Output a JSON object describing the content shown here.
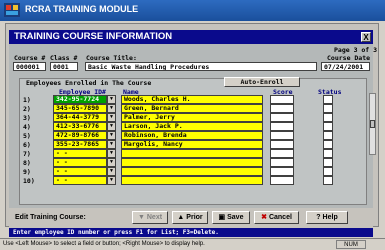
{
  "window": {
    "title": "RCRA TRAINING MODULE",
    "logo_icon": "rcra-logo-icon"
  },
  "form": {
    "title": "TRAINING COURSE INFORMATION",
    "close_label": "X",
    "page_info": "Page 3 of 3",
    "headers": {
      "course_num": "Course #",
      "class_num": "Class #",
      "course_title": "Course Title:",
      "course_date": "Course Date"
    },
    "values": {
      "course_num": "000001",
      "class_num": "0001",
      "course_title": "Basic Waste Handling Procedures",
      "course_date": "07/24/2001"
    }
  },
  "enrollment": {
    "section_label": "Employees Enrolled in The Course",
    "auto_enroll_label": "Auto-Enroll",
    "columns": {
      "employee_id": "Employee ID#",
      "name": "Name",
      "score": "Score",
      "status": "Status"
    },
    "rows": [
      {
        "num": "1)",
        "id": "342-95-7724",
        "name": "Woods, Charles H."
      },
      {
        "num": "2)",
        "id": "345-65-7890",
        "name": "Green, Bernard"
      },
      {
        "num": "3)",
        "id": "364-44-3779",
        "name": "Palmer, Jerry"
      },
      {
        "num": "4)",
        "id": "412-33-6776",
        "name": "Larson, Jack P."
      },
      {
        "num": "5)",
        "id": "472-89-8766",
        "name": "Robinson, Brenda"
      },
      {
        "num": "6)",
        "id": "355-23-7865",
        "name": "Margolis, Nancy"
      },
      {
        "num": "7)",
        "id": "- -",
        "name": ""
      },
      {
        "num": "8)",
        "id": "- -",
        "name": ""
      },
      {
        "num": "9)",
        "id": "- -",
        "name": ""
      },
      {
        "num": "10)",
        "id": "- -",
        "name": ""
      }
    ]
  },
  "toolbar": {
    "label": "Edit Training Course:",
    "next": "Next",
    "prior": "Prior",
    "save": "Save",
    "cancel": "Cancel",
    "help": "Help"
  },
  "hint": "Enter employee ID number or press F1 for List; F3=Delete.",
  "statusbar": {
    "message": "Use <Left Mouse> to select a field or button; <Right Mouse> to display help.",
    "num": "NUM"
  }
}
